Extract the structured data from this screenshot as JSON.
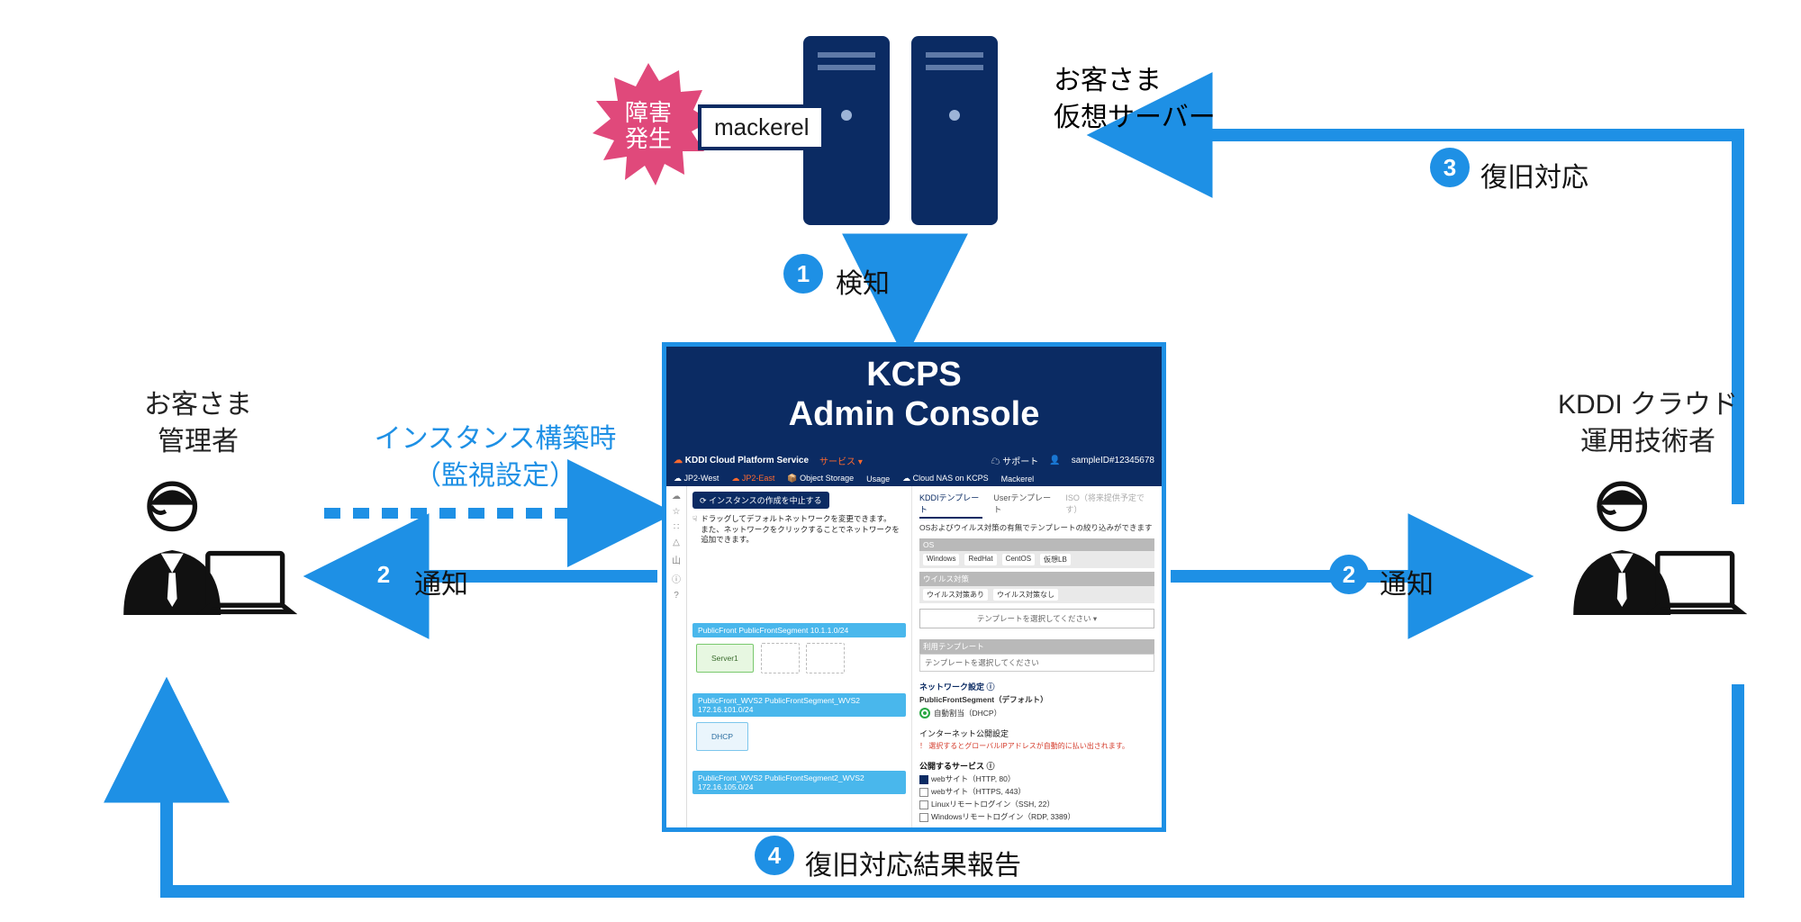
{
  "burst": {
    "line1": "障害",
    "line2": "発生"
  },
  "mackerel_chip": "mackerel",
  "server_label": {
    "l1": "お客さま",
    "l2": "仮想サーバー"
  },
  "actors": {
    "customer": {
      "l1": "お客さま",
      "l2": "管理者"
    },
    "engineer": {
      "l1": "KDDI クラウド",
      "l2": "運用技術者"
    }
  },
  "annotations": {
    "instance": {
      "l1": "インスタンス構築時",
      "l2": "（監視設定）"
    }
  },
  "steps": {
    "1": {
      "num": "1",
      "label": "検知"
    },
    "2a": {
      "num": "2",
      "label": "通知"
    },
    "2b": {
      "num": "2",
      "label": "通知"
    },
    "3": {
      "num": "3",
      "label": "復旧対応"
    },
    "4": {
      "num": "4",
      "label": "復旧対応結果報告"
    }
  },
  "console": {
    "title1": "KCPS",
    "title2": "Admin Console",
    "header": {
      "brand": "KDDI Cloud Platform Service",
      "service": "サービス ▾",
      "support": "☁ サポート",
      "user_icon": "👤",
      "user": "sampleID#12345678"
    },
    "tabbar": {
      "jp2w": "☁ JP2-West",
      "jp2e": "☁ JP2-East",
      "obj": "📦 Object Storage",
      "usage": "Usage",
      "nas": "☁ Cloud NAS on KCPS",
      "mack": "Mackerel"
    },
    "side": [
      "☁",
      "☆",
      "∷",
      "△",
      "山",
      "ⓘ",
      "?"
    ],
    "left": {
      "stop_btn": "⟳ インスタンスの作成を中止する",
      "drag_icon": "☟",
      "drag1": "ドラッグしてデフォルトネットワークを変更できます。",
      "drag2": "また、ネットワークをクリックすることでネットワークを追加できます。",
      "net1": "PublicFront PublicFrontSegment 10.1.1.0/24",
      "server1": "Server1",
      "net2": "PublicFront_WVS2 PublicFrontSegment_WVS2 172.16.101.0/24",
      "dhcp": "DHCP",
      "net3": "PublicFront_WVS2 PublicFrontSegment2_WVS2 172.16.105.0/24"
    },
    "right": {
      "tab_kddi": "KDDIテンプレート",
      "tab_user": "Userテンプレート",
      "tab_iso": "ISO（将来提供予定です）",
      "os_note": "OSおよびウイルス対策の有無でテンプレートの絞り込みができます",
      "os_head": "OS",
      "os_opts": [
        "Windows",
        "RedHat",
        "CentOS",
        "仮想LB"
      ],
      "virus_head": "ウイルス対策",
      "virus_opts": [
        "ウイルス対策あり",
        "ウイルス対策なし"
      ],
      "select_placeholder": "テンプレートを選択してください ▾",
      "used_tpl_head": "利用テンプレート",
      "used_tpl_val": "テンプレートを選択してください",
      "net_head": "ネットワーク設定 ⓘ",
      "net_seg": "PublicFrontSegment（デフォルト）",
      "dhcp_radio": "自動割当（DHCP）",
      "inet_head": "インターネット公開設定",
      "inet_warn": "！ 選択するとグローバルIPアドレスが自動的に払い出されます。",
      "svc_head": "公開するサービス ⓘ",
      "svc_http": "webサイト（HTTP, 80）",
      "svc_https": "webサイト（HTTPS, 443）",
      "svc_ssh": "Linuxリモートログイン（SSH, 22）",
      "svc_rdp": "Windowsリモートログイン（RDP, 3389）"
    }
  }
}
